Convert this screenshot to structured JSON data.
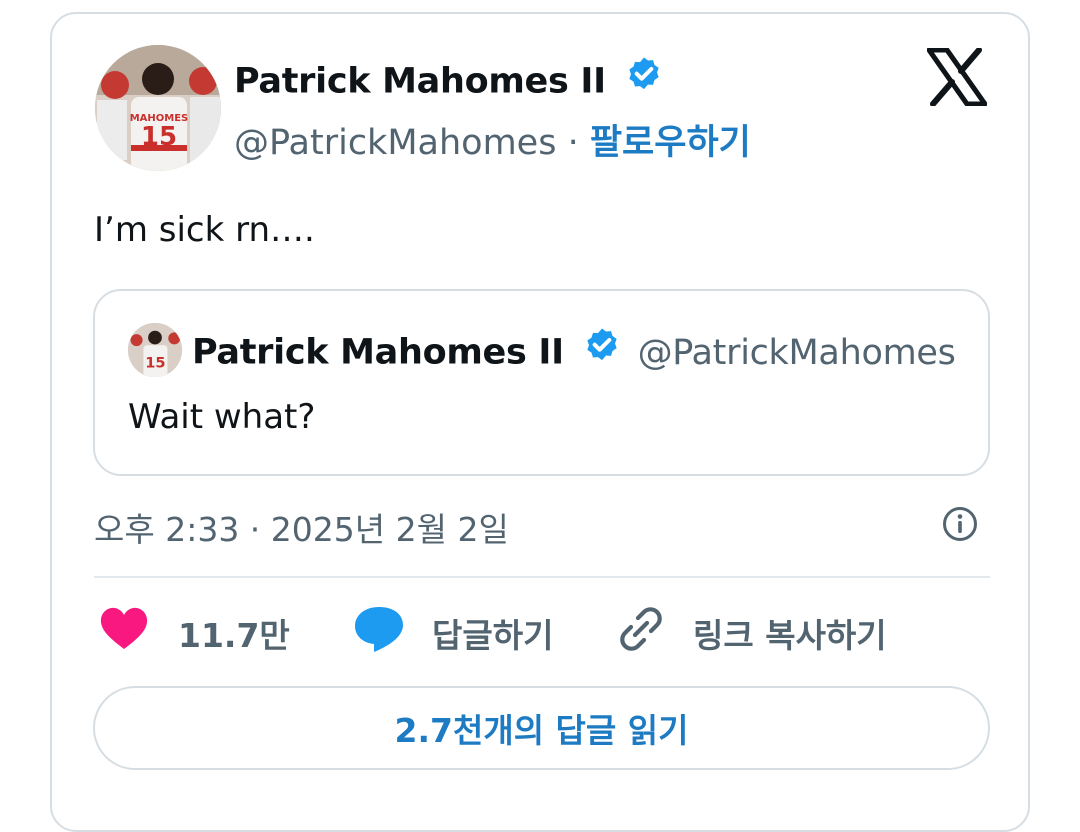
{
  "tweet": {
    "author_name": "Patrick Mahomes II",
    "handle": "@PatrickMahomes",
    "separator": "·",
    "follow_label": "팔로우하기",
    "text": "I’m sick rn….",
    "avatar_jersey_name": "MAHOMES",
    "avatar_jersey_number": "15"
  },
  "quoted": {
    "author_name": "Patrick Mahomes II",
    "handle": "@PatrickMahomes",
    "text": "Wait what?"
  },
  "meta": {
    "timestamp": "오후 2:33 · 2025년 2월 2일"
  },
  "actions": {
    "like_count": "11.7만",
    "reply_label": "답글하기",
    "copy_link_label": "링크 복사하기"
  },
  "read_replies_label": "2.7천개의 답글 읽기",
  "icons": [
    "x-logo-icon",
    "verified-badge-icon",
    "info-icon",
    "heart-icon",
    "reply-bubble-icon",
    "link-icon"
  ],
  "colors": {
    "accent": "#1d9bf0",
    "link": "#1d7bc4",
    "heart": "#f91880",
    "muted": "#536471"
  }
}
